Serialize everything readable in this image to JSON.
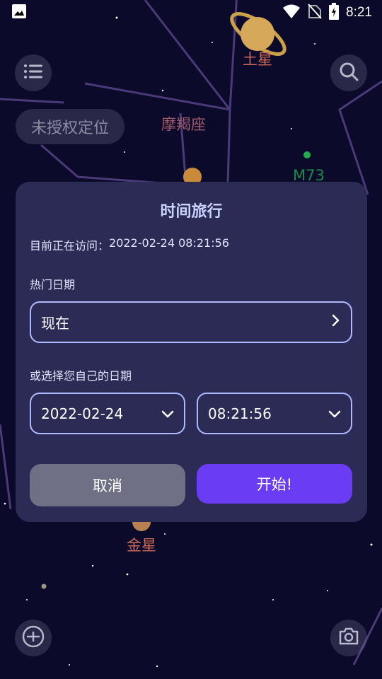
{
  "status_bar": {
    "time": "8:21"
  },
  "sky": {
    "labels": {
      "saturn": "土星",
      "capricorn": "摩羯座",
      "m73": "M73",
      "venus": "金星"
    },
    "location_pill": "未授权定位"
  },
  "dialog": {
    "title": "时间旅行",
    "visiting_label": "目前正在访问：",
    "visiting_value": "2022-02-24 08:21:56",
    "popular_dates_label": "热门日期",
    "popular_date_selected": "现在",
    "custom_date_label": "或选择您自己的日期",
    "date_value": "2022-02-24",
    "time_value": "08:21:56",
    "cancel_label": "取消",
    "start_label": "开始!"
  },
  "colors": {
    "background": "#0c0a2a",
    "dialog": "#2b2b55",
    "accent": "#6a3df5",
    "field_border": "#aeb9ff"
  }
}
